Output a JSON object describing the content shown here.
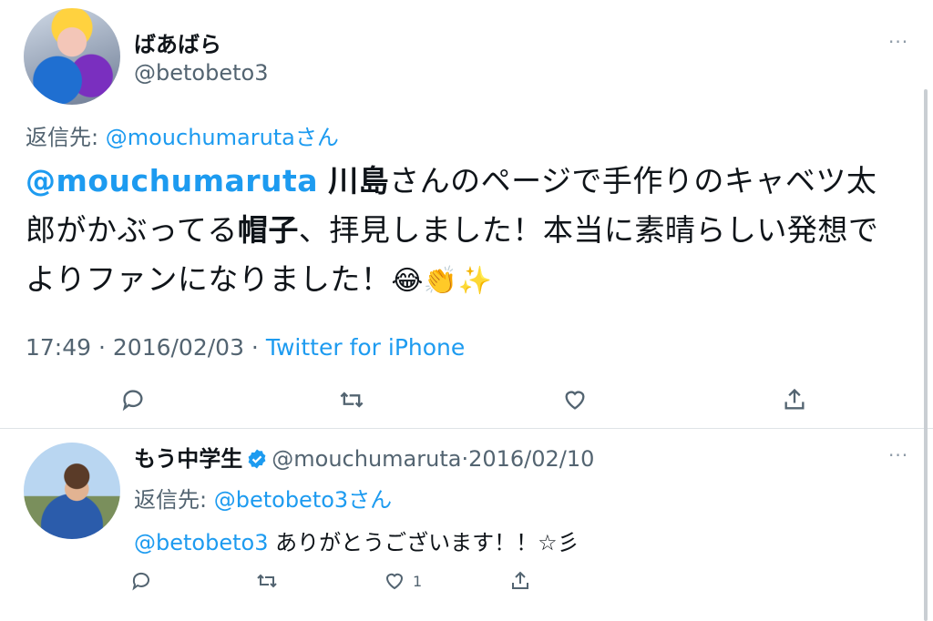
{
  "tweet": {
    "author_name": "ばあばら",
    "author_handle": "@betobeto3",
    "more": "···",
    "replying_prefix": "返信先: ",
    "replying_to": "@mouchumarutaさん",
    "body": {
      "mention": "@mouchumaruta",
      "t1": " ",
      "b1": "川島",
      "t2": "さんのページで手作りのキャベツ太郎がかぶってる",
      "b2": "帽子",
      "t3": "、拝見しました！本当に素晴らしい発想でよりファンになりました！",
      "emoji": "😂👏✨"
    },
    "time": "17:49",
    "sep1": " · ",
    "date": "2016/02/03",
    "sep2": " · ",
    "source": "Twitter for iPhone",
    "actions": [
      "reply-icon",
      "retweet-icon",
      "like-icon",
      "share-icon"
    ]
  },
  "reply": {
    "author_name": "もう中学生",
    "author_handle": "@mouchumaruta",
    "sep": "·",
    "date": "2016/02/10",
    "more": "···",
    "replying_prefix": "返信先: ",
    "replying_to": "@betobeto3さん",
    "mention": "@betobeto3",
    "text": " ありがとうございます！！☆彡",
    "like_count": "1",
    "actions": [
      "reply-icon",
      "retweet-icon",
      "like-icon",
      "share-icon"
    ]
  },
  "colors": {
    "accent": "#1d9bf0",
    "muted": "#536471",
    "text": "#0f1419"
  }
}
